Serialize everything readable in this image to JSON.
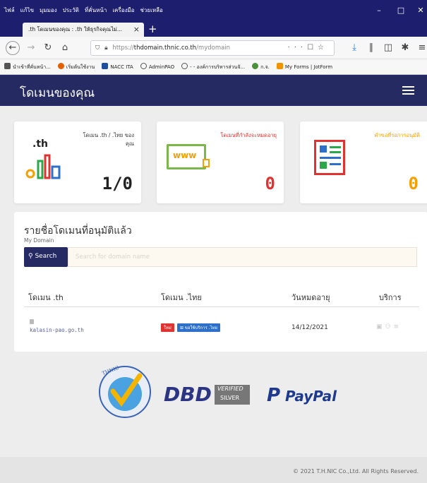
{
  "browser": {
    "menu": [
      "ไฟล์",
      "แก้ไข",
      "มุมมอง",
      "ประวัติ",
      "ที่คั่นหน้า",
      "เครื่องมือ",
      "ช่วยเหลือ"
    ],
    "tab_title": ".th โดเมนของคุณ : .th ให้ธุรกิจคุณไม่...",
    "url_prefix": "https://",
    "url_host": "thdomain.thnic.co.th",
    "url_path": "/mydomain",
    "bookmarks": [
      "นำเข้าที่คั่นหน้า...",
      "เริ่มต้นใช้งาน",
      "NACC ITA",
      "AdminPAO",
      "- - องค์การบริหารส่วนจั...",
      "ก.จ.",
      "My Forms | JotForm"
    ]
  },
  "header": {
    "title": "โดเมนของคุณ"
  },
  "cards": [
    {
      "logo_text": ".th",
      "label": "โดเมน .th / .ไทย ของคุณ",
      "value": "1/0"
    },
    {
      "logo_text": "www",
      "label": "โดเมนที่กำลังจะหมดอายุ",
      "value": "0"
    },
    {
      "label": "คำขอที่รอการอนุมัติ",
      "value": "0"
    }
  ],
  "panel": {
    "title": "รายชื่อโดเมนที่อนุมัติแล้ว",
    "subtitle": "My Domain",
    "search_button": "Search",
    "search_placeholder": "Search for domain name",
    "columns": [
      "โดเมน .th",
      "โดเมน .ไทย",
      "วันหมดอายุ",
      "บริการ"
    ],
    "rows": [
      {
        "domain_th": "kalasin-pao.go.th",
        "tag_new": "ใหม่",
        "tag_request": "ขอใช้บริการ .ไทย",
        "expiry": "14/12/2021"
      }
    ]
  },
  "badges": {
    "paypal": "PayPal",
    "dbd_main": "DBD",
    "dbd_verified": "VERIFIED",
    "dbd_silver": "SILVER",
    "thnic": "THNIC"
  },
  "footer": {
    "copyright": "© 2021 T.H.NIC Co.,Ltd. All Rights Reserved."
  },
  "colors": {
    "header": "#262a63",
    "tag_new": "#e0322e",
    "tag_request": "#2e6fc9",
    "value_dark": "#222222",
    "value_red": "#e0322e",
    "value_orange": "#f4a000"
  }
}
